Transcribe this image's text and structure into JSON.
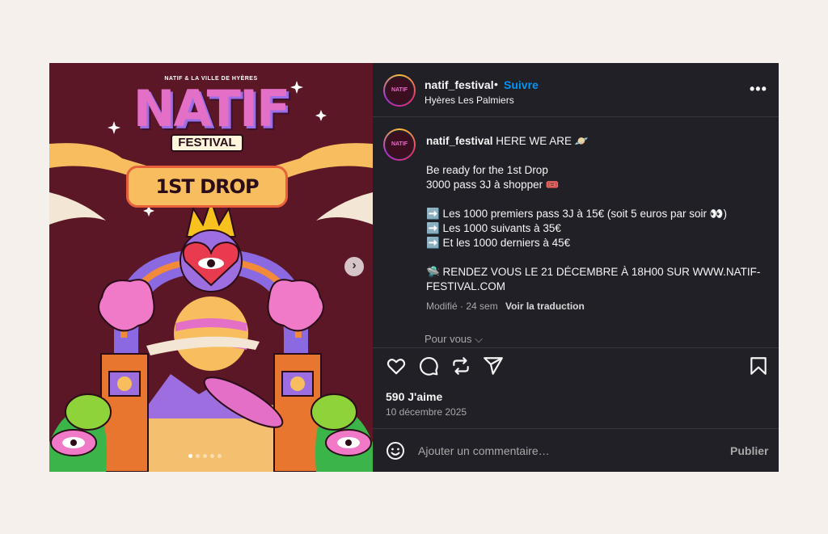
{
  "poster": {
    "top_line": "NATIF & LA VILLE DE HYÈRES",
    "title": "NATIF",
    "subtitle": "FESTIVAL",
    "banner": "1ST DROP",
    "slide_count": 5,
    "active_slide": 1
  },
  "header": {
    "username": "natif_festival",
    "separator": "•",
    "follow_label": "Suivre",
    "location": "Hyères Les Palmiers",
    "avatar_text": "NATIF"
  },
  "caption": {
    "username": "natif_festival",
    "headline": "HERE WE ARE 🪐",
    "line1": "Be ready for the 1st Drop",
    "line2": "3000 pass 3J à shopper 🎟️",
    "line3": "➡️ Les 1000 premiers pass 3J à 15€ (soit 5 euros par soir 👀)",
    "line4": "➡️ Les 1000 suivants à 35€",
    "line5": "➡️ Et les 1000 derniers à 45€",
    "line6": "🛸 RENDEZ VOUS LE 21 DÉCEMBRE À 18H00 SUR WWW.NATIF-",
    "line7": "FESTIVAL.COM"
  },
  "meta": {
    "modified": "Modifié · 24 sem",
    "translate": "Voir la traduction"
  },
  "for_you": "Pour vous ⌵",
  "stats": {
    "likes": "590 J'aime",
    "date": "10 décembre 2025"
  },
  "comment": {
    "placeholder": "Ajouter un commentaire…",
    "publish_label": "Publier"
  },
  "colors": {
    "panel_bg": "#222027",
    "page_bg": "#f5f0ec",
    "follow_blue": "#0095f6",
    "poster_bg": "#5b1725"
  }
}
